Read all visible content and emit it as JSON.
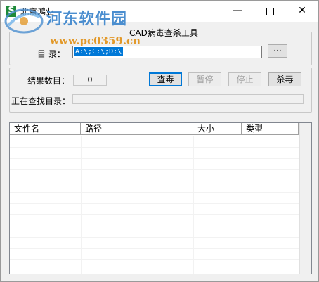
{
  "window": {
    "title": "北京鸿业",
    "icon": "S"
  },
  "watermark": {
    "site_name": "河东软件园",
    "url": "www.pc0359.cn"
  },
  "scan_group": {
    "legend": "CAD病毒查杀工具",
    "dir_label": "目 录：",
    "dir_value": "A:\\;C:\\;D:\\",
    "browse_label": "···"
  },
  "result_group": {
    "count_label": "结果数目：",
    "count_value": "0",
    "scan_button": "查毒",
    "pause_button": "暂停",
    "stop_button": "停止",
    "kill_button": "杀毒",
    "searching_label": "正在查找目录："
  },
  "list": {
    "columns": [
      "文件名",
      "路径",
      "大小",
      "类型"
    ]
  },
  "colors": {
    "selection": "#0078d7",
    "watermark_blue": "#4b8ecf",
    "watermark_orange": "#e2992a",
    "icon_green": "#1e8a3a"
  }
}
